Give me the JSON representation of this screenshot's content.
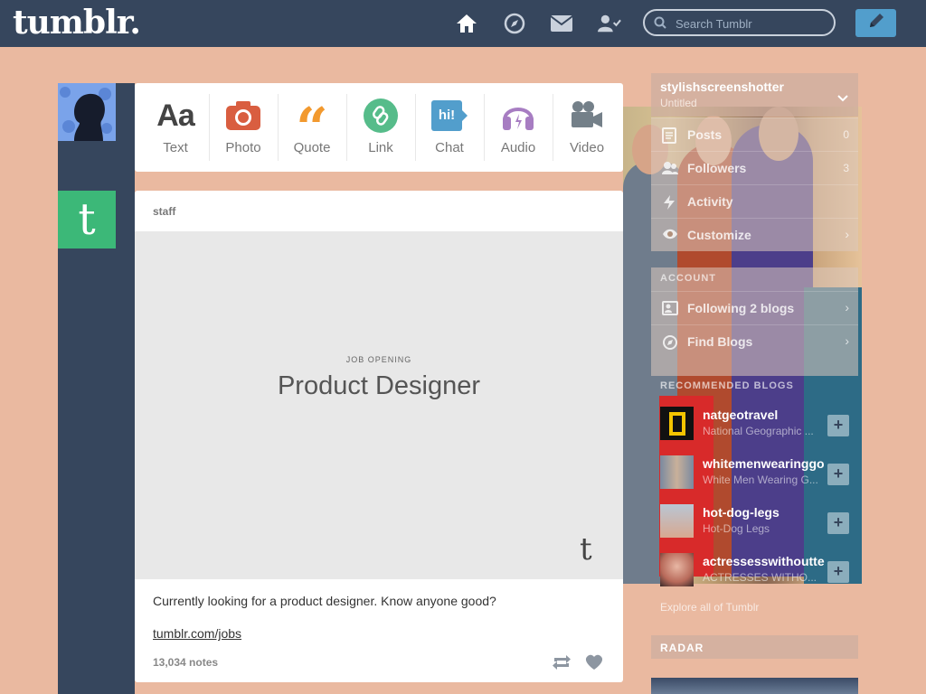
{
  "header": {
    "logo": "tumblr.",
    "search_placeholder": "Search Tumblr",
    "nav_icons": [
      "home-icon",
      "explore-icon",
      "inbox-icon",
      "account-icon"
    ],
    "compose_icon": "pencil-icon",
    "colors": {
      "bar": "#36465d",
      "compose": "#529ecc",
      "page_bg": "#eab9a0"
    }
  },
  "post_types": [
    {
      "label": "Text",
      "icon": "text-icon",
      "color": "#444444"
    },
    {
      "label": "Photo",
      "icon": "camera-icon",
      "color": "#d95e40"
    },
    {
      "label": "Quote",
      "icon": "quote-icon",
      "color": "#f2992e"
    },
    {
      "label": "Link",
      "icon": "link-icon",
      "color": "#56bc8a"
    },
    {
      "label": "Chat",
      "icon": "chat-icon",
      "color": "#529ecc",
      "badge": "hi!"
    },
    {
      "label": "Audio",
      "icon": "headphones-icon",
      "color": "#a77dc2"
    },
    {
      "label": "Video",
      "icon": "video-camera-icon",
      "color": "#748089"
    }
  ],
  "post": {
    "author": "staff",
    "image_label": "JOB OPENING",
    "image_title": "Product Designer",
    "image_logo": "t",
    "body": "Currently looking for a product designer. Know anyone good?",
    "link": "tumblr.com/jobs",
    "notes": "13,034 notes"
  },
  "sidebar": {
    "blog_name": "stylishscreenshotter",
    "blog_subtitle": "Untitled",
    "blog_rows": [
      {
        "label": "Posts",
        "count": "0",
        "icon": "posts-icon"
      },
      {
        "label": "Followers",
        "count": "3",
        "icon": "followers-icon"
      },
      {
        "label": "Activity",
        "count": "",
        "icon": "activity-icon"
      },
      {
        "label": "Customize",
        "count": "",
        "icon": "customize-icon"
      }
    ],
    "account_title": "ACCOUNT",
    "account_rows": [
      {
        "label": "Following 2 blogs",
        "icon": "following-icon"
      },
      {
        "label": "Find Blogs",
        "icon": "find-blogs-icon"
      }
    ],
    "recommended_title": "RECOMMENDED BLOGS",
    "recommended": [
      {
        "name": "natgeotravel",
        "subtitle": "National Geographic ...",
        "avatar_color": "#1a1a1a"
      },
      {
        "name": "whitemenwearinggoog",
        "subtitle": "White Men Wearing G...",
        "avatar_color": "#6d7f95"
      },
      {
        "name": "hot-dog-legs",
        "subtitle": "Hot-Dog Legs",
        "avatar_color": "#a8b6c8"
      },
      {
        "name": "actressesswithoutteeth",
        "subtitle": "ACTRESSES WITHO...",
        "avatar_color": "#c97a6b"
      }
    ],
    "explore_link": "Explore all of Tumblr",
    "radar_title": "RADAR"
  }
}
